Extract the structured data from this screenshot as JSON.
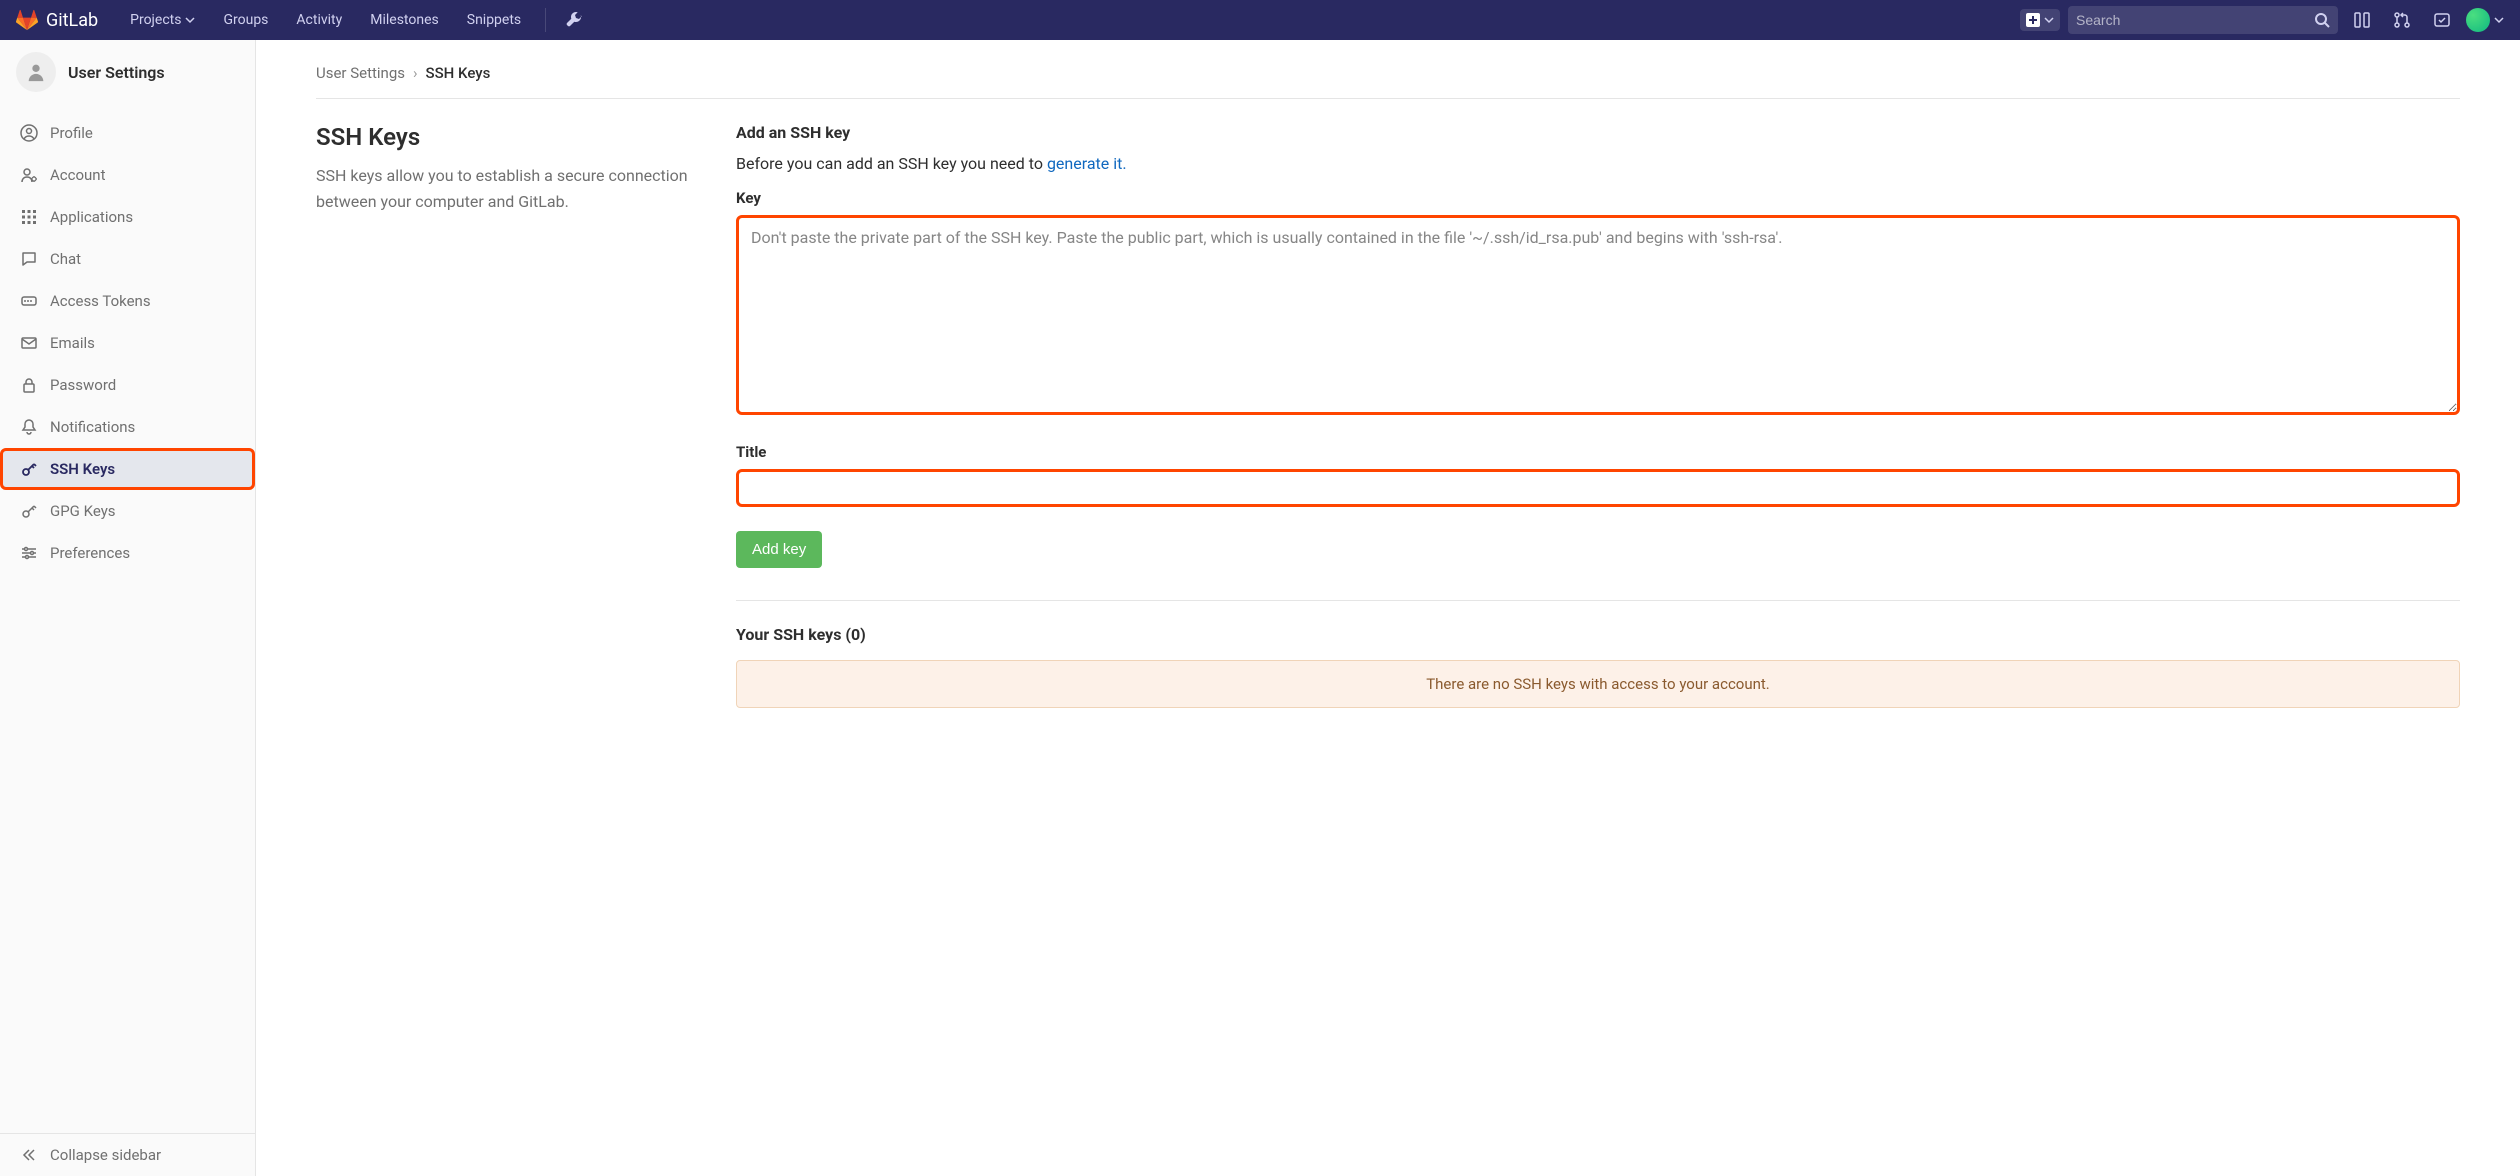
{
  "navbar": {
    "brand": "GitLab",
    "items": [
      "Projects",
      "Groups",
      "Activity",
      "Milestones",
      "Snippets"
    ],
    "search_placeholder": "Search"
  },
  "sidebar": {
    "title": "User Settings",
    "items": [
      {
        "label": "Profile",
        "icon": "profile"
      },
      {
        "label": "Account",
        "icon": "account"
      },
      {
        "label": "Applications",
        "icon": "applications"
      },
      {
        "label": "Chat",
        "icon": "chat"
      },
      {
        "label": "Access Tokens",
        "icon": "access-tokens"
      },
      {
        "label": "Emails",
        "icon": "emails"
      },
      {
        "label": "Password",
        "icon": "password"
      },
      {
        "label": "Notifications",
        "icon": "notifications"
      },
      {
        "label": "SSH Keys",
        "icon": "ssh-keys",
        "active": true,
        "highlighted": true
      },
      {
        "label": "GPG Keys",
        "icon": "gpg-keys"
      },
      {
        "label": "Preferences",
        "icon": "preferences"
      }
    ],
    "collapse": "Collapse sidebar"
  },
  "breadcrumb": {
    "parent": "User Settings",
    "current": "SSH Keys"
  },
  "page": {
    "heading": "SSH Keys",
    "description": "SSH keys allow you to establish a secure connection between your computer and GitLab.",
    "form_heading": "Add an SSH key",
    "intro_before": "Before you can add an SSH key you need to ",
    "intro_link": "generate it.",
    "key_label": "Key",
    "key_placeholder": "Don't paste the private part of the SSH key. Paste the public part, which is usually contained in the file '~/.ssh/id_rsa.pub' and begins with 'ssh-rsa'.",
    "title_label": "Title",
    "add_button": "Add key",
    "your_keys_heading": "Your SSH keys (0)",
    "empty_message": "There are no SSH keys with access to your account."
  }
}
